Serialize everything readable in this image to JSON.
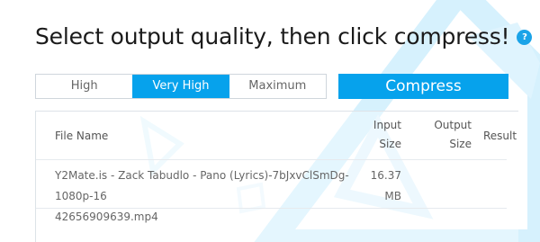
{
  "heading": {
    "text": "Select output quality, then click compress!",
    "help_icon": "?"
  },
  "quality": {
    "options": [
      "High",
      "Very High",
      "Maximum"
    ],
    "selected": "Very High"
  },
  "compress_button": "Compress",
  "table": {
    "headers": {
      "file_name": "File Name",
      "input_size_line1": "Input",
      "input_size_line2": "Size",
      "output_size_line1": "Output",
      "output_size_line2": "Size",
      "result": "Result"
    },
    "rows": [
      {
        "file_name_line1": "Y2Mate.is - Zack Tabudlo - Pano (Lyrics)-7bJxvClSmDg-1080p-16",
        "file_name_line2": "42656909639.mp4",
        "input_size_line1": "16.37",
        "input_size_line2": "MB",
        "output_size": "",
        "result": ""
      }
    ]
  },
  "colors": {
    "accent": "#06a2ec",
    "decor": "#cdeefc"
  }
}
